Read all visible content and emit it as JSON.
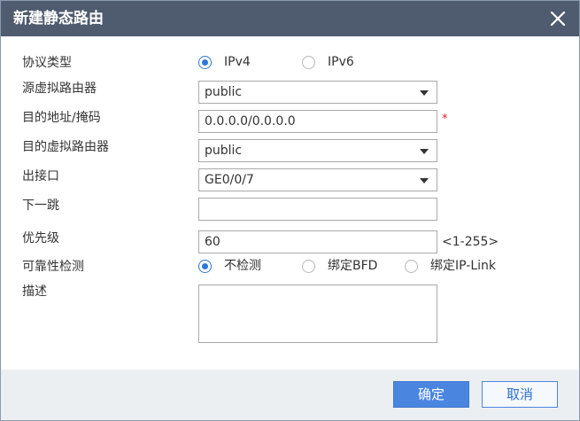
{
  "dialog": {
    "title": "新建静态路由"
  },
  "icons": {
    "close": "close-icon",
    "dropdown": "chevron-down-icon"
  },
  "form": {
    "protocol": {
      "label": "协议类型",
      "options": [
        "IPv4",
        "IPv6"
      ],
      "selected": "IPv4"
    },
    "source_vr": {
      "label": "源虚拟路由器",
      "value": "public"
    },
    "dest_mask": {
      "label": "目的地址/掩码",
      "value": "0.0.0.0/0.0.0.0",
      "required_mark": "*"
    },
    "dest_vr": {
      "label": "目的虚拟路由器",
      "value": "public"
    },
    "out_interface": {
      "label": "出接口",
      "value": "GE0/0/7"
    },
    "next_hop": {
      "label": "下一跳",
      "value": ""
    },
    "priority": {
      "label": "优先级",
      "value": "60",
      "range_hint": "<1-255>"
    },
    "reliability": {
      "label": "可靠性检测",
      "options": [
        "不检测",
        "绑定BFD",
        "绑定IP-Link"
      ],
      "selected": "不检测"
    },
    "description": {
      "label": "描述",
      "value": ""
    }
  },
  "buttons": {
    "ok": "确定",
    "cancel": "取消"
  },
  "colors": {
    "titlebar": "#4f5b6e",
    "accent": "#4a86e0",
    "required": "#e02020",
    "footer": "#eceff2"
  }
}
